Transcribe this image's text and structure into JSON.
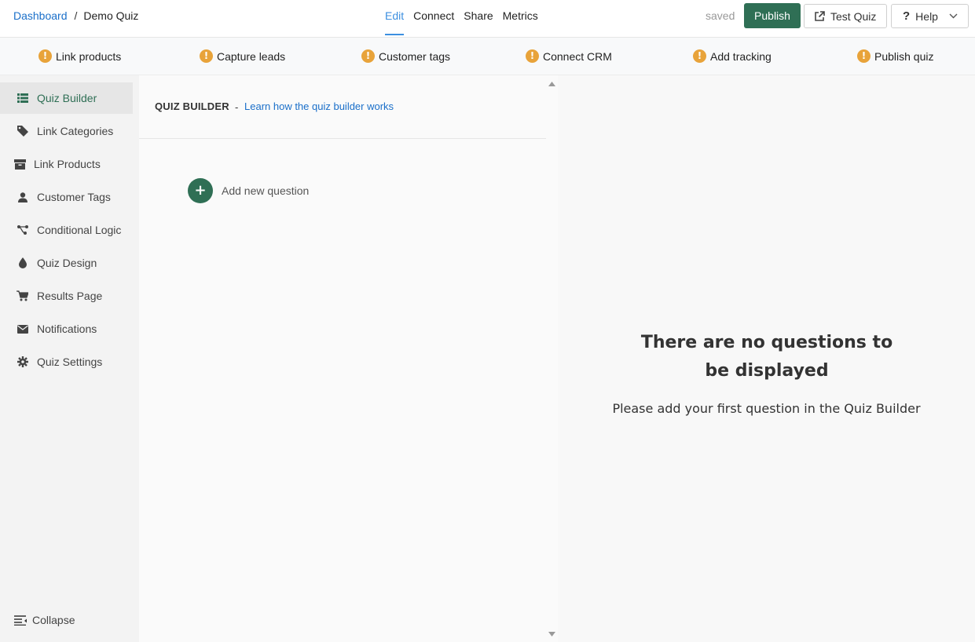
{
  "header": {
    "breadcrumb": {
      "root": "Dashboard",
      "separator": "/",
      "current": "Demo Quiz"
    },
    "tabs": [
      {
        "label": "Edit",
        "active": true
      },
      {
        "label": "Connect",
        "active": false
      },
      {
        "label": "Share",
        "active": false
      },
      {
        "label": "Metrics",
        "active": false
      }
    ],
    "status": "saved",
    "publish_label": "Publish",
    "test_label": "Test Quiz",
    "help_label": "Help"
  },
  "steps": [
    {
      "label": "Link products",
      "icon": "warning-icon"
    },
    {
      "label": "Capture leads",
      "icon": "warning-icon"
    },
    {
      "label": "Customer tags",
      "icon": "warning-icon"
    },
    {
      "label": "Connect CRM",
      "icon": "warning-icon"
    },
    {
      "label": "Add tracking",
      "icon": "warning-icon"
    },
    {
      "label": "Publish quiz",
      "icon": "warning-icon"
    }
  ],
  "sidebar": {
    "items": [
      {
        "label": "Quiz Builder",
        "icon": "list-icon",
        "active": true
      },
      {
        "label": "Link Categories",
        "icon": "tag-icon"
      },
      {
        "label": "Link Products",
        "icon": "box-icon"
      },
      {
        "label": "Customer Tags",
        "icon": "user-icon"
      },
      {
        "label": "Conditional Logic",
        "icon": "branch-icon"
      },
      {
        "label": "Quiz Design",
        "icon": "droplet-icon"
      },
      {
        "label": "Results Page",
        "icon": "cart-icon"
      },
      {
        "label": "Notifications",
        "icon": "envelope-icon"
      },
      {
        "label": "Quiz Settings",
        "icon": "gear-icon"
      }
    ],
    "collapse_label": "Collapse"
  },
  "builder": {
    "title": "QUIZ BUILDER",
    "dash": "-",
    "help_link": "Learn how the quiz builder works",
    "add_button": "+",
    "add_label": "Add new question"
  },
  "preview": {
    "empty_title": "There are no questions to be displayed",
    "empty_subtitle": "Please add your first question in the Quiz Builder"
  },
  "colors": {
    "brand_green": "#2f6f55",
    "link_blue": "#1a6fc9",
    "active_tab": "#3c8fe0",
    "warning": "#e8a33a"
  }
}
